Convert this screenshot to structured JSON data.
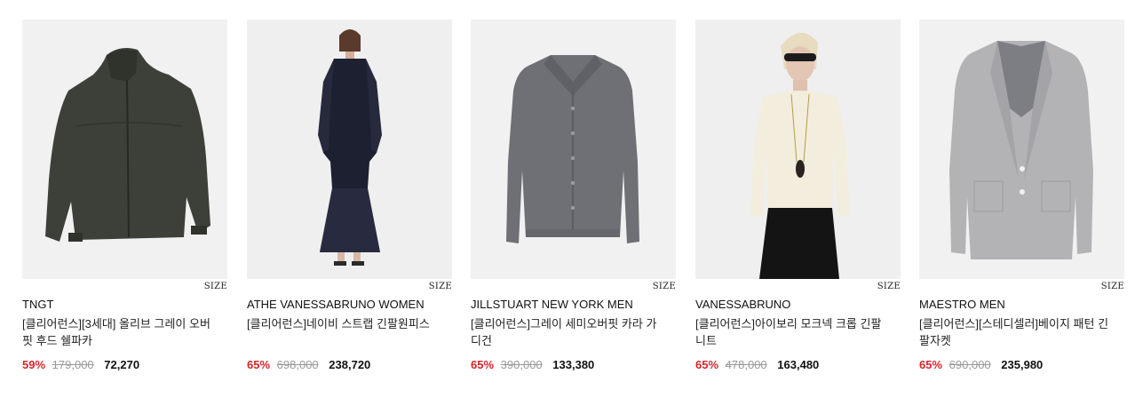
{
  "products": [
    {
      "brand": "TNGT",
      "name": "[클리어런스][3세대] 올리브 그레이 오버핏 후드 쉘파카",
      "size_label": "SIZE",
      "discount": "59%",
      "original_price": "179,000",
      "sale_price": "72,270",
      "image": "olive-hooded-jacket"
    },
    {
      "brand": "ATHE VANESSABRUNO WOMEN",
      "name": "[클리어런스]네이비 스트랩 긴팔원피스",
      "size_label": "SIZE",
      "discount": "65%",
      "original_price": "698,000",
      "sale_price": "238,720",
      "image": "navy-long-dress"
    },
    {
      "brand": "JILLSTUART NEW YORK MEN",
      "name": "[클리어런스]그레이 세미오버핏 카라 가디건",
      "size_label": "SIZE",
      "discount": "65%",
      "original_price": "390,000",
      "sale_price": "133,380",
      "image": "gray-collar-cardigan"
    },
    {
      "brand": "VANESSABRUNO",
      "name": "[클리어런스]아이보리 모크넥 크롭 긴팔니트",
      "size_label": "SIZE",
      "discount": "65%",
      "original_price": "478,000",
      "sale_price": "163,480",
      "image": "ivory-mockneck-knit"
    },
    {
      "brand": "MAESTRO MEN",
      "name": "[클리어런스][스테디셀러]베이지 패턴 긴팔자켓",
      "size_label": "SIZE",
      "discount": "65%",
      "original_price": "690,000",
      "sale_price": "235,980",
      "image": "gray-blazer"
    }
  ],
  "colors": {
    "discount": "#d9232a",
    "original_price": "#9a9a9a",
    "image_bg": "#f2f2f2"
  }
}
